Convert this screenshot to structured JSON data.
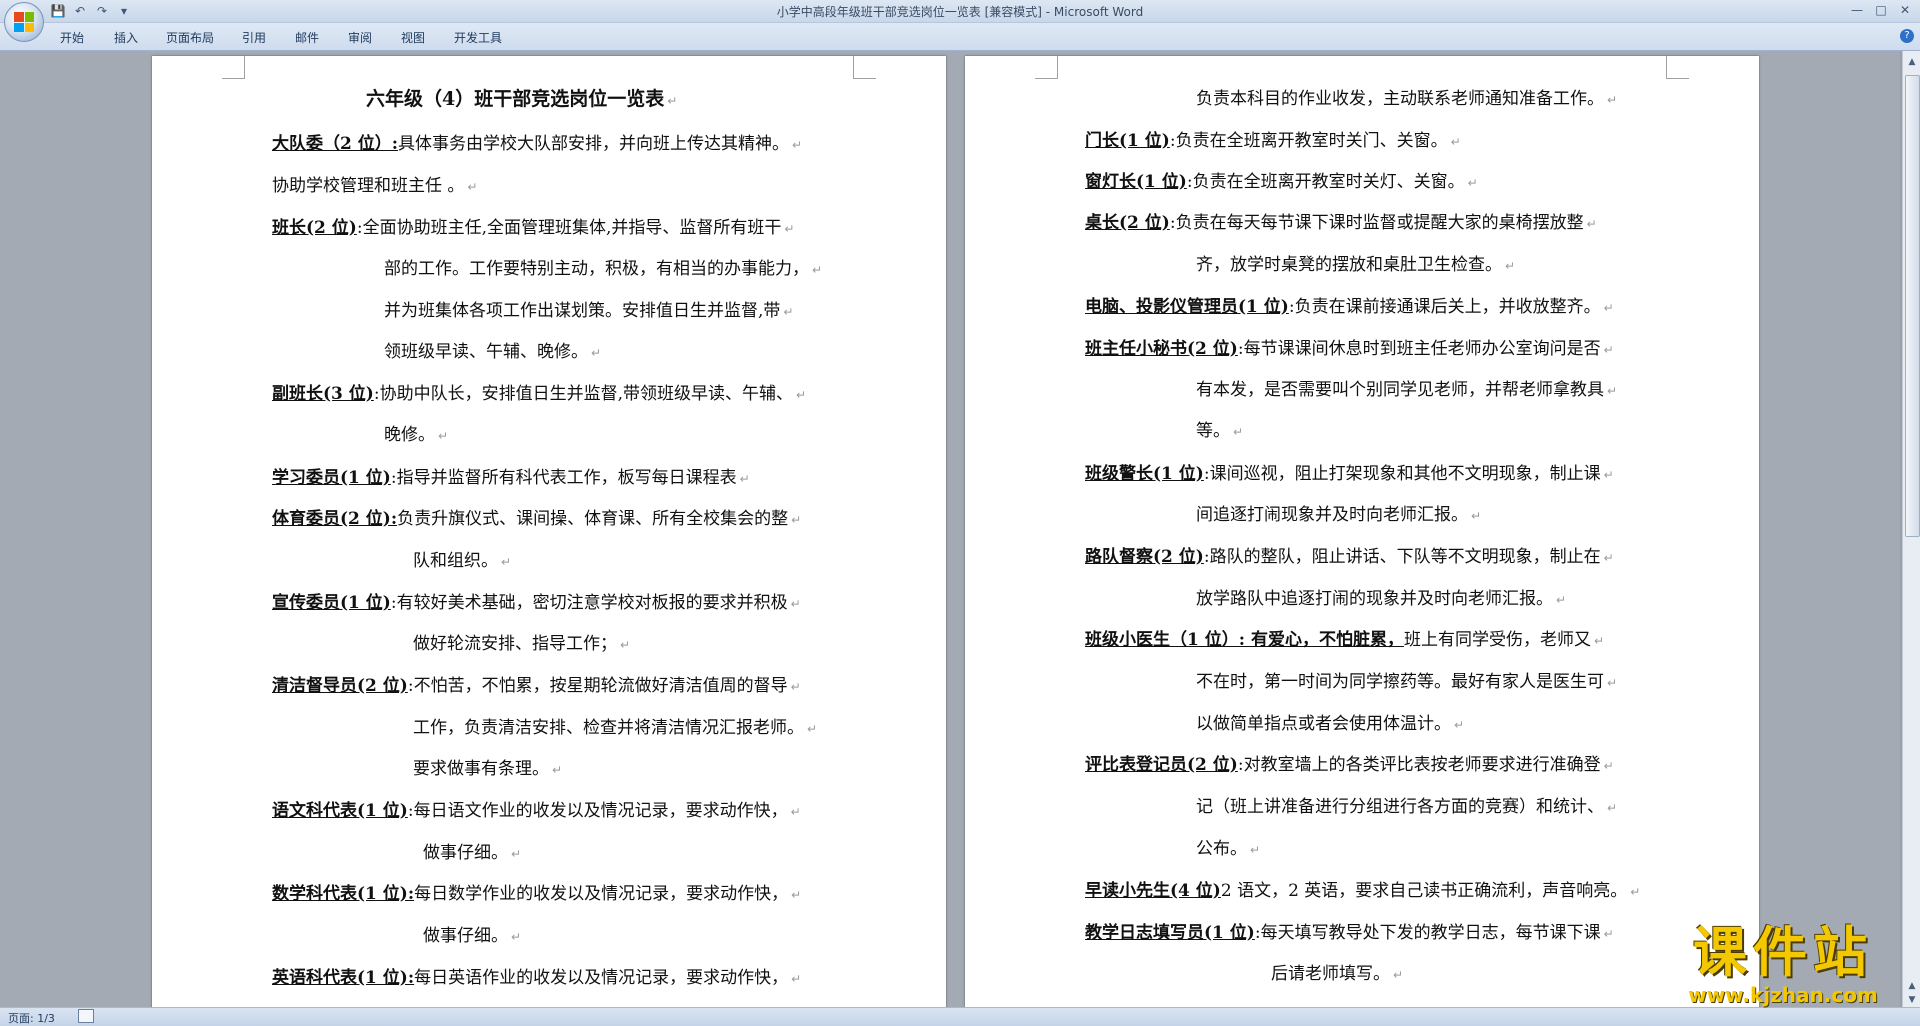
{
  "window": {
    "title": "小学中高段年级班干部竞选岗位一览表 [兼容模式] - Microsoft Word"
  },
  "quick_access": {
    "icons": [
      "save-icon",
      "undo-icon",
      "redo-icon",
      "customize-dropdown-icon"
    ]
  },
  "ribbon": {
    "tabs": [
      "开始",
      "插入",
      "页面布局",
      "引用",
      "邮件",
      "审阅",
      "视图",
      "开发工具"
    ]
  },
  "page1": {
    "title": "六年级（4）班干部竞选岗位一览表",
    "lines": [
      {
        "label": "大队委（2 位）:",
        "text": "具体事务由学校大队部安排，并向班上传达其精神。"
      },
      {
        "label": "",
        "text": "协助学校管理和班主任 。"
      },
      {
        "label": "班长(2  位)",
        "text": ":全面协助班主任,全面管理班集体,并指导、监督所有班干"
      },
      {
        "label": "",
        "text": "部的工作。工作要特别主动，积极，有相当的办事能力，"
      },
      {
        "label": "",
        "text": "并为班集体各项工作出谋划策。安排值日生并监督,带"
      },
      {
        "label": "",
        "text": "领班级早读、午辅、晚修。"
      },
      {
        "label": "副班长(3 位)",
        "text": ":协助中队长，安排值日生并监督,带领班级早读、午辅、"
      },
      {
        "label": "",
        "text": "晚修。"
      },
      {
        "label": "学习委员(1 位)",
        "text": ":指导并监督所有科代表工作，板写每日课程表"
      },
      {
        "label": "体育委员(2 位):",
        "text": "负责升旗仪式、课间操、体育课、所有全校集会的整"
      },
      {
        "label": "",
        "text": "队和组织。"
      },
      {
        "label": "宣传委员(1 位)",
        "text": ":有较好美术基础，密切注意学校对板报的要求并积极"
      },
      {
        "label": "",
        "text": "做好轮流安排、指导工作；"
      },
      {
        "label": "清洁督导员(2 位)",
        "text": ":不怕苦，不怕累，按星期轮流做好清洁值周的督导"
      },
      {
        "label": "",
        "text": "工作，负责清洁安排、检查并将清洁情况汇报老师。"
      },
      {
        "label": "",
        "text": "要求做事有条理。"
      },
      {
        "label": "语文科代表(1 位)",
        "text": ":每日语文作业的收发以及情况记录，要求动作快，"
      },
      {
        "label": "",
        "text": "做事仔细。"
      },
      {
        "label": "数学科代表(1 位):",
        "text": "每日数学作业的收发以及情况记录，要求动作快，"
      },
      {
        "label": "",
        "text": "做事仔细。"
      },
      {
        "label": "英语科代表(1 位):",
        "text": "每日英语作业的收发以及情况记录，要求动作快，"
      }
    ]
  },
  "page2": {
    "lines": [
      {
        "label": "",
        "text": "负责本科目的作业收发，主动联系老师通知准备工作。"
      },
      {
        "label": "门长(1 位)",
        "text": ":负责在全班离开教室时关门、关窗。"
      },
      {
        "label": "窗灯长(1 位)",
        "text": ":负责在全班离开教室时关灯、关窗。"
      },
      {
        "label": "桌长(2  位)",
        "text": ":负责在每天每节课下课时监督或提醒大家的桌椅摆放整"
      },
      {
        "label": "",
        "text": "齐，放学时桌凳的摆放和桌肚卫生检查。"
      },
      {
        "label": "电脑、投影仪管理员(1 位)",
        "text": ":负责在课前接通课后关上，并收放整齐。"
      },
      {
        "label": "班主任小秘书(2 位)",
        "text": ":每节课课间休息时到班主任老师办公室询问是否"
      },
      {
        "label": "",
        "text": "有本发，是否需要叫个别同学见老师，并帮老师拿教具"
      },
      {
        "label": "",
        "text": "等。"
      },
      {
        "label": "班级警长(1 位)",
        "text": ":课间巡视，阻止打架现象和其他不文明现象，制止课"
      },
      {
        "label": "",
        "text": "间追逐打闹现象并及时向老师汇报。"
      },
      {
        "label": "路队督察(2 位)",
        "text": ":路队的整队，阻止讲话、下队等不文明现象，制止在"
      },
      {
        "label": "",
        "text": "放学路队中追逐打闹的现象并及时向老师汇报。"
      },
      {
        "label": "班级小医生（1 位）: 有爱心，不怕脏累，",
        "text": "班上有同学受伤，老师又"
      },
      {
        "label": "",
        "text": "不在时，第一时间为同学擦药等。最好有家人是医生可"
      },
      {
        "label": "",
        "text": "以做简单指点或者会使用体温计。"
      },
      {
        "label": "评比表登记员(2 位)",
        "text": ":对教室墙上的各类评比表按老师要求进行准确登"
      },
      {
        "label": "",
        "text": "记（班上讲准备进行分组进行各方面的竞赛）和统计、"
      },
      {
        "label": "",
        "text": "公布。"
      },
      {
        "label": "早读小先生(4 位)",
        "text": "2 语文，2 英语，要求自己读书正确流利，声音响亮。"
      },
      {
        "label": "教学日志填写员(1 位)",
        "text": ":每天填写教导处下发的教学日志，每节课下课"
      },
      {
        "label": "",
        "text": "后请老师填写。"
      }
    ]
  },
  "status": {
    "page_info": "页面: 1/3"
  },
  "watermark": {
    "big": "课件站",
    "small": "www.kjzhan.com"
  },
  "colors": {
    "background": "#a3aab3",
    "ribbon": "#cfdcee",
    "watermark": "#f3c800"
  }
}
